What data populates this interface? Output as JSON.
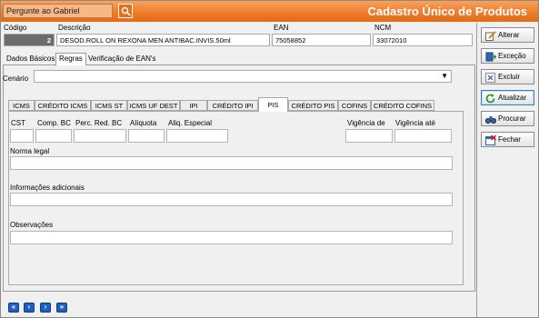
{
  "titlebar": {
    "ask_text": "Pergunte ao Gabriel",
    "ask_icon": "help-search-icon",
    "title": "Cadastro Único de Produtos"
  },
  "header": {
    "codigo_label": "Código",
    "codigo_value": "2",
    "descricao_label": "Descrição",
    "descricao_value": "DESOD.ROLL ON REXONA MEN ANTIBAC.INVIS.50ml",
    "ean_label": "EAN",
    "ean_value": "75058852",
    "ncm_label": "NCM",
    "ncm_value": "33072010"
  },
  "main_tabs": [
    {
      "label": "Dados Básicos",
      "active": false
    },
    {
      "label": "Regras",
      "active": true
    },
    {
      "label": "Verificação de EAN's",
      "active": false
    }
  ],
  "cenario": {
    "label": "Cenário",
    "value": ""
  },
  "sub_tabs": [
    {
      "label": "ICMS",
      "active": false
    },
    {
      "label": "CRÉDITO ICMS",
      "active": false
    },
    {
      "label": "ICMS ST",
      "active": false
    },
    {
      "label": "ICMS UF DEST",
      "active": false
    },
    {
      "label": "IPI",
      "active": false
    },
    {
      "label": "CRÉDITO IPI",
      "active": false
    },
    {
      "label": "PIS",
      "active": true
    },
    {
      "label": "CRÉDITO PIS",
      "active": false
    },
    {
      "label": "COFINS",
      "active": false
    },
    {
      "label": "CRÉDITO COFINS",
      "active": false
    }
  ],
  "pis_form": {
    "cst_label": "CST",
    "comp_bc_label": "Comp. BC",
    "perc_red_bc_label": "Perc. Red. BC",
    "aliquota_label": "Alíquota",
    "aliq_especial_label": "Aliq. Especial",
    "vigencia_de_label": "Vigência de",
    "vigencia_ate_label": "Vigência até",
    "norma_legal_label": "Norma legal",
    "info_adicionais_label": "Informações adicionais",
    "observacoes_label": "Observações"
  },
  "actions": [
    {
      "label": "Alterar",
      "icon": "pencil-icon"
    },
    {
      "label": "Exceção",
      "icon": "exit-door-icon"
    },
    {
      "label": "Excluir",
      "icon": "delete-x-icon"
    },
    {
      "label": "Atualizar",
      "icon": "refresh-icon"
    },
    {
      "label": "Procurar",
      "icon": "binoculars-icon"
    },
    {
      "label": "Fechar",
      "icon": "close-window-icon"
    }
  ],
  "navigation": {
    "first_glyph": "«",
    "prev_glyph": "‹",
    "next_glyph": "›",
    "last_glyph": "»"
  },
  "colors": {
    "titlebar": "#ee7d2c",
    "codigo_bg": "#6c6c6c",
    "nav_buttons": "#1f5fc0"
  }
}
